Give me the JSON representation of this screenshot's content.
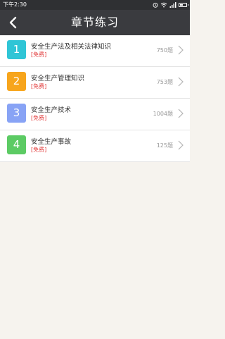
{
  "status_bar": {
    "time": "下午2:30",
    "icons": [
      "alarm-icon",
      "wifi-icon",
      "signal-icon",
      "battery-icon"
    ],
    "battery_level": 0.55
  },
  "header": {
    "title": "章节练习",
    "back_icon": "back-arrow-icon"
  },
  "colors": {
    "status_bar_bg": "#2f3033",
    "navbar_bg": "#3a3b3f",
    "free_tag": "#e23b3b",
    "page_bg": "#f6f3ee"
  },
  "chapters": [
    {
      "number": "1",
      "title": "安全生产法及相关法律知识",
      "tag": "[免费]",
      "count": "750题",
      "color": "#2fc5d6"
    },
    {
      "number": "2",
      "title": "安全生产管理知识",
      "tag": "[免费]",
      "count": "753题",
      "color": "#f7a51c"
    },
    {
      "number": "3",
      "title": "安全生产技术",
      "tag": "[免费]",
      "count": "1004题",
      "color": "#88a3f5"
    },
    {
      "number": "4",
      "title": "安全生产事故",
      "tag": "[免费]",
      "count": "125题",
      "color": "#5ccb64"
    }
  ]
}
